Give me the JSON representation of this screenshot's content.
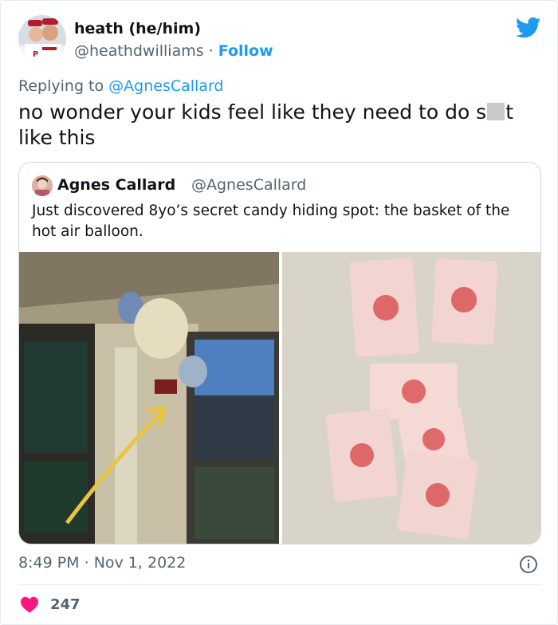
{
  "author": {
    "name": "heath (he/him)",
    "handle": "@heathdwilliams",
    "separator": " · ",
    "follow_label": "Follow"
  },
  "reply": {
    "prefix": "Replying to ",
    "to_handle": "@AgnesCallard"
  },
  "tweet": {
    "text_before": "no wonder your kids feel like they need to do s",
    "text_after": "t like this"
  },
  "quoted": {
    "name": "Agnes Callard",
    "handle": "@AgnesCallard",
    "text": "Just discovered 8yo’s secret candy hiding spot: the basket of the hot air balloon."
  },
  "meta": {
    "time": "8:49 PM",
    "separator": " · ",
    "date": "Nov 1, 2022"
  },
  "engagement": {
    "likes": "247"
  },
  "icons": {
    "brand": "twitter-bird-icon",
    "info": "info-icon",
    "like": "heart-icon"
  },
  "colors": {
    "twitter_blue": "#1d9bf0",
    "heart_red": "#f91880",
    "text_primary": "#0f1419",
    "text_secondary": "#536471",
    "border": "#cfd9de",
    "arrow_yellow": "#e8c541"
  }
}
